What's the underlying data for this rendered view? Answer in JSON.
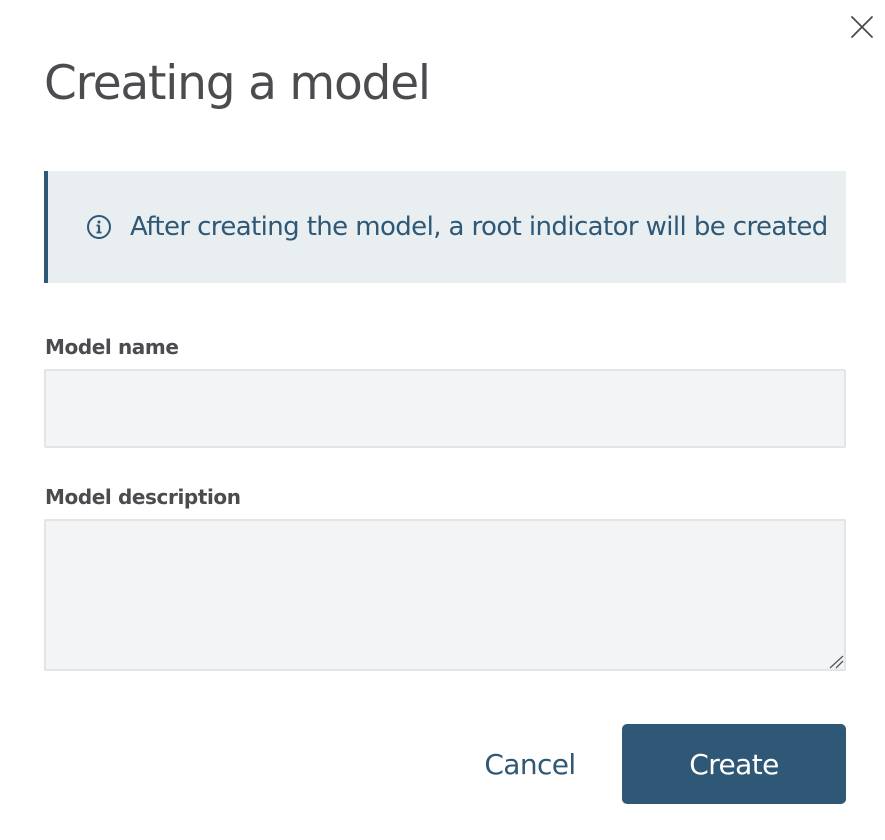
{
  "dialog": {
    "title": "Creating a model",
    "close_icon": "close-icon"
  },
  "info": {
    "icon": "info-circle-icon",
    "text": "After creating the model, a root indicator will be created"
  },
  "form": {
    "name_label": "Model name",
    "name_value": "",
    "description_label": "Model description",
    "description_value": ""
  },
  "actions": {
    "cancel_label": "Cancel",
    "create_label": "Create"
  },
  "colors": {
    "accent": "#2f5876",
    "info_background": "#e9eef1",
    "input_background": "#f3f4f5",
    "title_text": "#4a4c4f"
  }
}
